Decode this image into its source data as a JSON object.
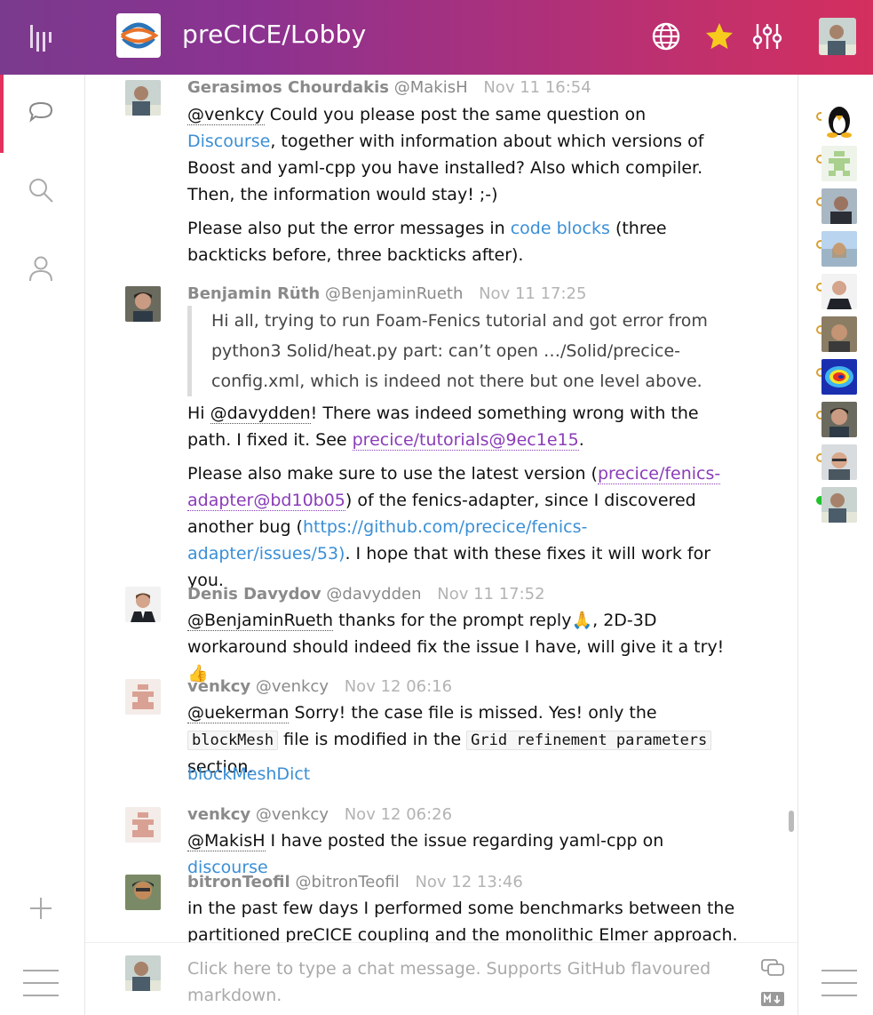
{
  "header": {
    "room_title": "preCICE/Lobby",
    "icons": [
      "gitter-bars-icon",
      "globe-icon",
      "star-icon",
      "settings-sliders-icon"
    ],
    "accent_star": "#f6cb1e"
  },
  "left_rail": {
    "icons": [
      "chat-bubble-icon",
      "search-icon",
      "person-icon",
      "add-icon",
      "menu-icon"
    ]
  },
  "messages": [
    {
      "name": "Gerasimos Chourdakis",
      "handle": "@MakisH",
      "time": "Nov 11 16:54",
      "p1_mention": "@venkcy",
      "p1_a": " Could you please post the same question on ",
      "p1_link": "Discourse",
      "p1_b": ", together with information about which versions of Boost and yaml-cpp you have installed? Also which compiler. Then, the information would stay! ;-)",
      "p2_a": "Please also put the error messages in ",
      "p2_link": "code blocks",
      "p2_b": " (three backticks before, three backticks after)."
    },
    {
      "name": "Benjamin Rüth",
      "handle": "@BenjaminRueth",
      "time": "Nov 11 17:25",
      "quote": "Hi all, trying to run Foam-Fenics tutorial and got error from python3 Solid/heat.py part: can’t open …/Solid/precice-config.xml, which is indeed not there but one level above.",
      "p1_a": "Hi ",
      "p1_mention": "@davydden",
      "p1_b": "! There was indeed something wrong with the path. I fixed it. See ",
      "p1_issue": "precice/tutorials@9ec1e15",
      "p1_c": ".",
      "p2_a": "Please also make sure to use the latest version (",
      "p2_issue": "precice/fenics-adapter@bd10b05",
      "p2_b": ") of the fenics-adapter, since I discovered another bug (",
      "p2_link": "https://github.com/precice/fenics-adapter/issues/53)",
      "p2_c": ". I hope that with these fixes it will work for you."
    },
    {
      "name": "Denis Davydov",
      "handle": "@davydden",
      "time": "Nov 11 17:52",
      "p1_mention": "@BenjaminRueth",
      "p1_a": " thanks for the prompt reply",
      "p1_emoji1": "🙏",
      "p1_b": ", 2D-3D workaround should indeed fix the issue I have, will give it a try!",
      "p1_emoji2": "👍"
    },
    {
      "name": "venkcy",
      "handle": "@venkcy",
      "time": "Nov 12 06:16",
      "p1_mention": "@uekerman",
      "p1_a": " Sorry! the case file is missed. Yes! only the ",
      "p1_code1": "blockMesh",
      "p1_b": " file is modified in the ",
      "p1_code2": "Grid refinement parameters",
      "p1_c": " section.",
      "p2_link": "blockMeshDict"
    },
    {
      "name": "venkcy",
      "handle": "@venkcy",
      "time": "Nov 12 06:26",
      "p1_mention": "@MakisH",
      "p1_a": " I have posted the issue regarding yaml-cpp on ",
      "p1_link": "discourse"
    },
    {
      "name": "bitronTeofil",
      "handle": "@bitronTeofil",
      "time": "Nov 12 13:46",
      "p1": "in the past few days I performed some benchmarks between the partitioned preCICE coupling and the monolithic Elmer approach."
    }
  ],
  "composer": {
    "placeholder": "Click here to type a chat message. Supports GitHub flavoured markdown.",
    "icons": [
      "chat-bubbles-icon",
      "markdown-icon"
    ]
  },
  "people": {
    "count_visible": 10,
    "online_index": 9
  }
}
